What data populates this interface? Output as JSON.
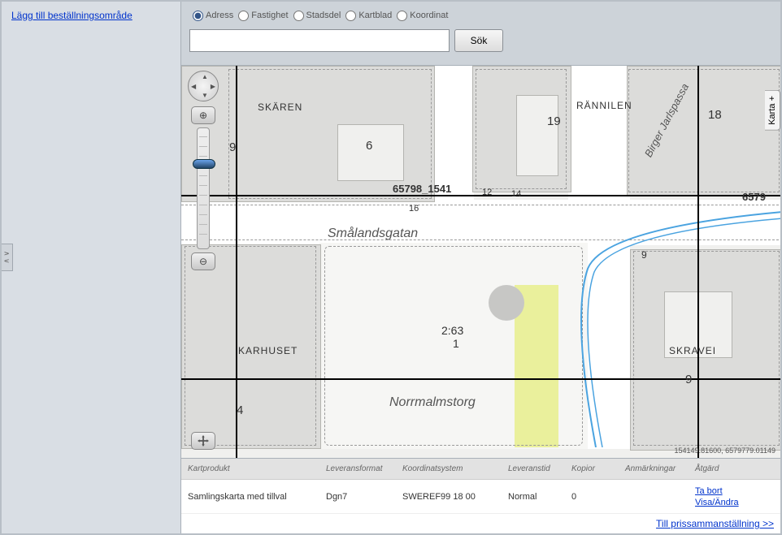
{
  "left_panel": {
    "add_area_link": "Lägg till beställningsområde"
  },
  "side_tab": "∧ ∨",
  "search": {
    "radios": {
      "adress": "Adress",
      "fastighet": "Fastighet",
      "stadsdel": "Stadsdel",
      "kartblad": "Kartblad",
      "koordinat": "Koordinat"
    },
    "selected": "adress",
    "value": "",
    "placeholder": "",
    "button": "Sök"
  },
  "map": {
    "karta_tab": "Karta +",
    "coords": "154149.81600, 6579779.01149",
    "labels": {
      "skaren": "SKÄREN",
      "rannilen": "RÄNNILEN",
      "karhuset": "KARHUSET",
      "skravei": "SKRAVEI",
      "smalandsgatan": "Smålandsgatan",
      "norrmalmstorg": "Norrmalmstorg",
      "birger": "Birger Jarlspassa",
      "g65798": "65798_1541",
      "g6579": "6579",
      "p263": "2:63",
      "p1": "1",
      "n6": "6",
      "n9": "9",
      "n19": "19",
      "n18": "18",
      "n4": "4",
      "n9b": "9",
      "n9c": "9",
      "n16": "16",
      "n12": "12",
      "n14": "14"
    }
  },
  "table": {
    "headers": {
      "product": "Kartprodukt",
      "format": "Leveransformat",
      "coord": "Koordinatsystem",
      "time": "Leveranstid",
      "copies": "Kopior",
      "notes": "Anmärkningar",
      "action": "Åtgärd"
    },
    "row": {
      "product": "Samlingskarta med tillval",
      "format": "Dgn7",
      "coord": "SWEREF99 18 00",
      "time": "Normal",
      "copies": "0",
      "notes": "",
      "action_remove": "Ta bort",
      "action_edit": "Visa/Ändra"
    }
  },
  "footer": {
    "link": "Till prissammanställning >>"
  },
  "zoom_in": "⊕",
  "zoom_out": "⊖"
}
